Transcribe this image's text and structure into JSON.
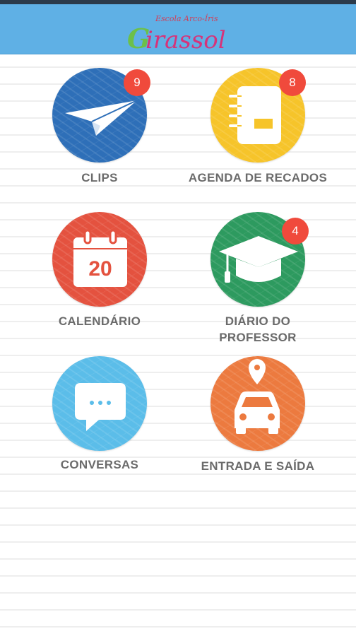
{
  "header": {
    "logo_text_top": "Escola Arco-Íris",
    "logo_text_main": "Girassol",
    "colors": {
      "background": "#5fb0e5",
      "topbar": "#2b3a4a"
    }
  },
  "menu": [
    {
      "id": "clips",
      "label": "CLIPS",
      "icon": "paper-plane-icon",
      "color": "#2e6fb8",
      "badge": "9"
    },
    {
      "id": "agenda",
      "label": "AGENDA DE RECADOS",
      "icon": "notebook-icon",
      "color": "#f6c42a",
      "badge": "8"
    },
    {
      "id": "calendario",
      "label": "CALENDÁRIO",
      "icon": "calendar-icon",
      "color": "#e4523f",
      "badge": "",
      "icon_text": "20"
    },
    {
      "id": "diario",
      "label_line1": "DIÁRIO DO",
      "label_line2": "PROFESSOR",
      "icon": "graduation-cap-icon",
      "color": "#2d9a5f",
      "badge": "4"
    },
    {
      "id": "conversas",
      "label": "CONVERSAS",
      "icon": "chat-bubble-icon",
      "color": "#5bbde9",
      "badge": ""
    },
    {
      "id": "entrada",
      "label": "ENTRADA E SAÍDA",
      "icon": "car-location-icon",
      "color": "#ec7a3f",
      "badge": ""
    }
  ]
}
